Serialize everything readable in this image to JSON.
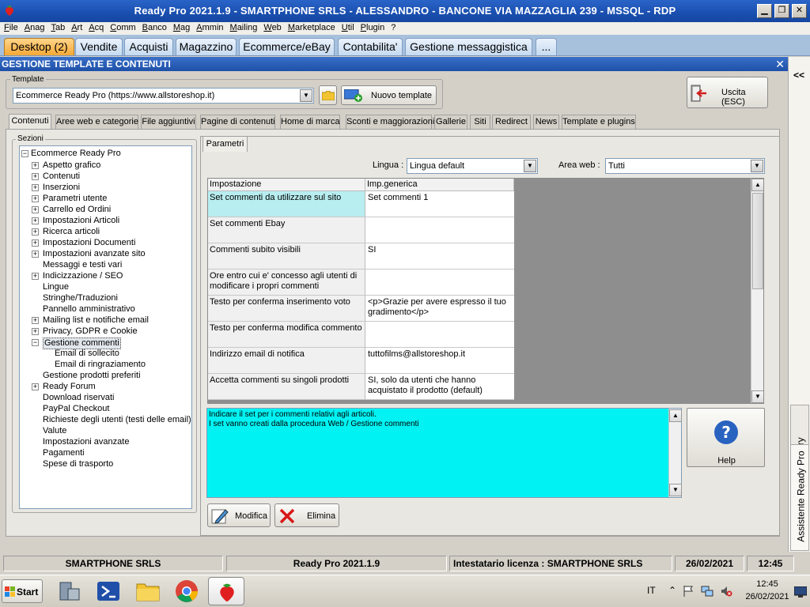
{
  "window": {
    "title": "Ready Pro 2021.1.9 - SMARTPHONE SRLS - ALESSANDRO - BANCONE VIA MAZZAGLIA 239 - MSSQL - RDP",
    "minimize": "▁",
    "restore": "❐",
    "close": "✕"
  },
  "menu": [
    "File",
    "Anag",
    "Tab",
    "Art",
    "Acq",
    "Comm",
    "Banco",
    "Mag",
    "Ammin",
    "Mailing",
    "Web",
    "Marketplace",
    "Util",
    "Plugin",
    "?"
  ],
  "top_tabs": [
    "Desktop (2)",
    "Vendite",
    "Acquisti",
    "Magazzino",
    "Ecommerce/eBay",
    "Contabilita'",
    "Gestione messaggistica",
    "..."
  ],
  "section": {
    "title": "GESTIONE TEMPLATE E CONTENUTI",
    "close": "✕"
  },
  "template": {
    "group_label": "Template",
    "selected": "Ecommerce Ready Pro (https://www.allstoreshop.it)",
    "new_button": "Nuovo template",
    "exit_button": "Uscita (ESC)"
  },
  "content_tabs": [
    "Contenuti",
    "Aree web e categorie",
    "File aggiuntivi",
    "Pagine di contenuti",
    "Home di marca",
    "Sconti e maggiorazioni",
    "Gallerie",
    "Siti",
    "Redirect",
    "News",
    "Template e plugins"
  ],
  "sections_label": "Sezioni",
  "tree": {
    "root": "Ecommerce Ready Pro",
    "items": [
      {
        "label": "Aspetto grafico",
        "expand": "+"
      },
      {
        "label": "Contenuti",
        "expand": "+"
      },
      {
        "label": "Inserzioni",
        "expand": "+"
      },
      {
        "label": "Parametri utente",
        "expand": "+"
      },
      {
        "label": "Carrello ed Ordini",
        "expand": "+"
      },
      {
        "label": "Impostazioni Articoli",
        "expand": "+"
      },
      {
        "label": "Ricerca articoli",
        "expand": "+"
      },
      {
        "label": "Impostazioni Documenti",
        "expand": "+"
      },
      {
        "label": "Impostazioni avanzate sito",
        "expand": "+"
      },
      {
        "label": "Messaggi e testi vari",
        "expand": ""
      },
      {
        "label": "Indicizzazione / SEO",
        "expand": "+"
      },
      {
        "label": "Lingue",
        "expand": ""
      },
      {
        "label": "Stringhe/Traduzioni",
        "expand": ""
      },
      {
        "label": "Pannello amministrativo",
        "expand": ""
      },
      {
        "label": "Mailing list e notifiche email",
        "expand": "+"
      },
      {
        "label": "Privacy, GDPR e Cookie",
        "expand": "+"
      },
      {
        "label": "Gestione commenti",
        "expand": "−"
      },
      {
        "label": "Email di sollecito",
        "expand": "",
        "child": true
      },
      {
        "label": "Email di ringraziamento",
        "expand": "",
        "child": true
      },
      {
        "label": "Gestione prodotti preferiti",
        "expand": ""
      },
      {
        "label": "Ready Forum",
        "expand": "+"
      },
      {
        "label": "Download riservati",
        "expand": ""
      },
      {
        "label": "PayPal Checkout",
        "expand": ""
      },
      {
        "label": "Richieste degli utenti (testi delle email)",
        "expand": ""
      },
      {
        "label": "Valute",
        "expand": ""
      },
      {
        "label": "Impostazioni avanzate",
        "expand": ""
      },
      {
        "label": "Pagamenti",
        "expand": ""
      },
      {
        "label": "Spese di trasporto",
        "expand": ""
      }
    ],
    "selected_index": 16
  },
  "params": {
    "tab": "Parametri",
    "lingua_label": "Lingua :",
    "lingua_value": "Lingua default",
    "area_label": "Area web :",
    "area_value": "Tutti",
    "columns": [
      "Impostazione",
      "Imp.generica"
    ],
    "rows": [
      {
        "name": "Set commenti da utilizzare sul sito",
        "value": "Set commenti 1"
      },
      {
        "name": "Set commenti Ebay",
        "value": ""
      },
      {
        "name": "Commenti subito visibili",
        "value": "SI"
      },
      {
        "name": "Ore entro cui e' concesso agli utenti di modificare i propri commenti",
        "value": ""
      },
      {
        "name": "Testo per conferma inserimento voto",
        "value": "<p>Grazie per avere espresso il tuo gradimento</p>"
      },
      {
        "name": "Testo per conferma modifica commento",
        "value": ""
      },
      {
        "name": "Indirizzo email di notifica",
        "value": "tuttofilms@allstoreshop.it"
      },
      {
        "name": "Accetta commenti su singoli prodotti",
        "value": "SI, solo da utenti che hanno acquistato il prodotto (default)"
      }
    ],
    "description": [
      "Indicare il set per i commenti relativi agli articoli.",
      "I set vanno creati dalla procedura Web / Gestione commenti"
    ],
    "help": "Help",
    "modify": "Modifica",
    "delete": "Elimina"
  },
  "side_tabs": [
    "History",
    "Assistente Ready Pro"
  ],
  "side_collapse": "<<",
  "status": {
    "company": "SMARTPHONE SRLS",
    "version": "Ready Pro 2021.1.9",
    "license": "Intestatario licenza : SMARTPHONE SRLS",
    "date": "26/02/2021",
    "time": "12:45"
  },
  "taskbar": {
    "start": "Start",
    "lang": "IT",
    "clock_time": "12:45",
    "clock_date": "26/02/2021"
  }
}
